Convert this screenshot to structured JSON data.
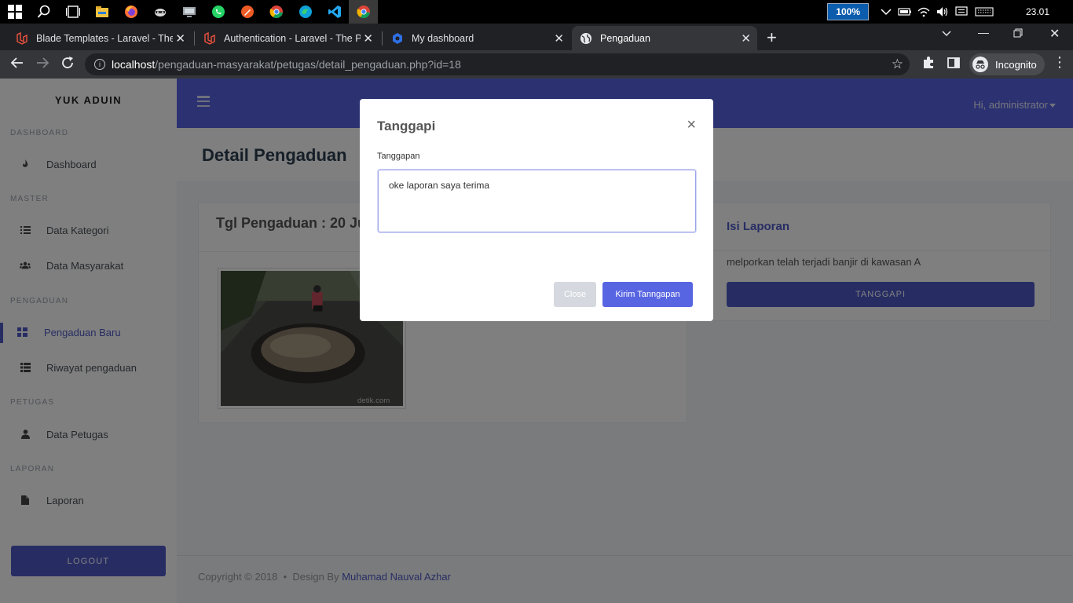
{
  "taskbar": {
    "zoom": "100%",
    "clock": "23.01",
    "apps": [
      "windows-start",
      "search",
      "task-view",
      "file-explorer",
      "firefox",
      "app-raccoon",
      "app-remote",
      "whatsapp",
      "app-orange",
      "chrome",
      "app-blue",
      "vscode",
      "chrome-active"
    ]
  },
  "browser": {
    "tabs": [
      {
        "title": "Blade Templates - Laravel - The P",
        "icon": "laravel-icon"
      },
      {
        "title": "Authentication - Laravel - The PH",
        "icon": "laravel-icon"
      },
      {
        "title": "My dashboard",
        "icon": "hexagon-icon"
      },
      {
        "title": "Pengaduan",
        "icon": "globe-icon"
      }
    ],
    "url_host": "localhost",
    "url_path": "/pengaduan-masyarakat/petugas/detail_pengaduan.php?id=18",
    "profile_label": "Incognito"
  },
  "sidebar": {
    "brand": "YUK ADUIN",
    "sections": [
      {
        "heading": "DASHBOARD",
        "items": [
          "Dashboard"
        ]
      },
      {
        "heading": "MASTER",
        "items": [
          "Data Kategori",
          "Data Masyarakat"
        ]
      },
      {
        "heading": "PENGADUAN",
        "items": [
          "Pengaduan Baru",
          "Riwayat pengaduan"
        ]
      },
      {
        "heading": "PETUGAS",
        "items": [
          "Data Petugas"
        ]
      },
      {
        "heading": "LAPORAN",
        "items": [
          "Laporan"
        ]
      }
    ],
    "active_item": "Pengaduan Baru",
    "logout_label": "LOGOUT"
  },
  "topnav": {
    "user_greeting": "Hi, administrator"
  },
  "page": {
    "title": "Detail Pengaduan",
    "left_card_title": "Tgl Pengaduan : 20 Ju",
    "image_watermark": "detik.com",
    "isi_title": "Isi Laporan",
    "isi_text": "melporkan telah terjadi banjir di kawasan A",
    "tanggapi_label": "TANGGAPI"
  },
  "footer": {
    "copyright": "Copyright © 2018  •  Design By ",
    "author": "Muhamad Nauval Azhar"
  },
  "modal": {
    "title": "Tanggapi",
    "close_glyph": "×",
    "field_label": "Tanggapan",
    "field_value": "oke laporan saya terima",
    "close_label": "Close",
    "submit_label": "Kirim Tanngapan"
  },
  "colors": {
    "primary": "#5865e2",
    "primary_dark": "#4e5bc7",
    "taskbar": "#000000",
    "chrome_dark": "#202124"
  }
}
